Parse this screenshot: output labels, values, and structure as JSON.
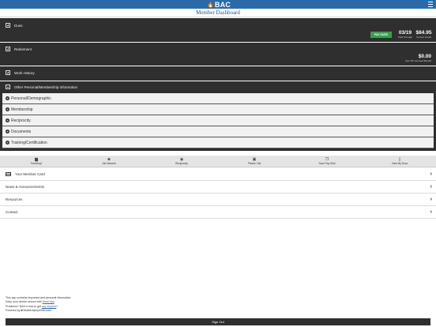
{
  "header": {
    "logo_text": "BAC",
    "title": "Member Dashboard"
  },
  "dues": {
    "label": "Dues",
    "pay_button": "PAY DUES",
    "paid_through_value": "03/19",
    "paid_through_label": "Paid Through",
    "current_credit_value": "$84.95",
    "current_credit_label": "Current Credit"
  },
  "retirement": {
    "label": "Retirement",
    "benefit_value": "$0.00",
    "benefit_label": "Est. IPF Accrued Benefit"
  },
  "work_history": {
    "label": "Work History"
  },
  "other_info": {
    "label": "Other Personal/Membership Information",
    "items": [
      {
        "label": "Personal/Demographic"
      },
      {
        "label": "Membership"
      },
      {
        "label": "Reciprocity"
      },
      {
        "label": "Documents"
      },
      {
        "label": "Training/Certification"
      }
    ]
  },
  "tabs": [
    {
      "label": "Traveling?",
      "icon": "suitcase-icon"
    },
    {
      "label": "Job Network",
      "icon": "people-icon"
    },
    {
      "label": "Reciprocity",
      "icon": "globe-icon"
    },
    {
      "label": "Please Call",
      "icon": "phone-icon"
    },
    {
      "label": "Scan Pay Stub",
      "icon": "copy-icon"
    },
    {
      "label": "View My Docs",
      "icon": "document-icon"
    }
  ],
  "links": [
    {
      "label": "Your Member Card"
    },
    {
      "label": "News & Announcements"
    },
    {
      "label": "Resources"
    },
    {
      "label": "Contact"
    }
  ],
  "footer": {
    "line1": "This app contains important and personal information.",
    "line2_prefix": "Keep your device secure with",
    "line2_link": "these tips",
    "line3_prefix": "Problems? Here's how to get",
    "line3_link": "app support",
    "line4": "Powered by",
    "line4_brand": "MuiltiemployerNet.com"
  },
  "signout_label": "Sign Out",
  "colors": {
    "topbar": "#2b6aa8",
    "panel": "#2f2f2f",
    "pay_button": "#34a34a"
  }
}
